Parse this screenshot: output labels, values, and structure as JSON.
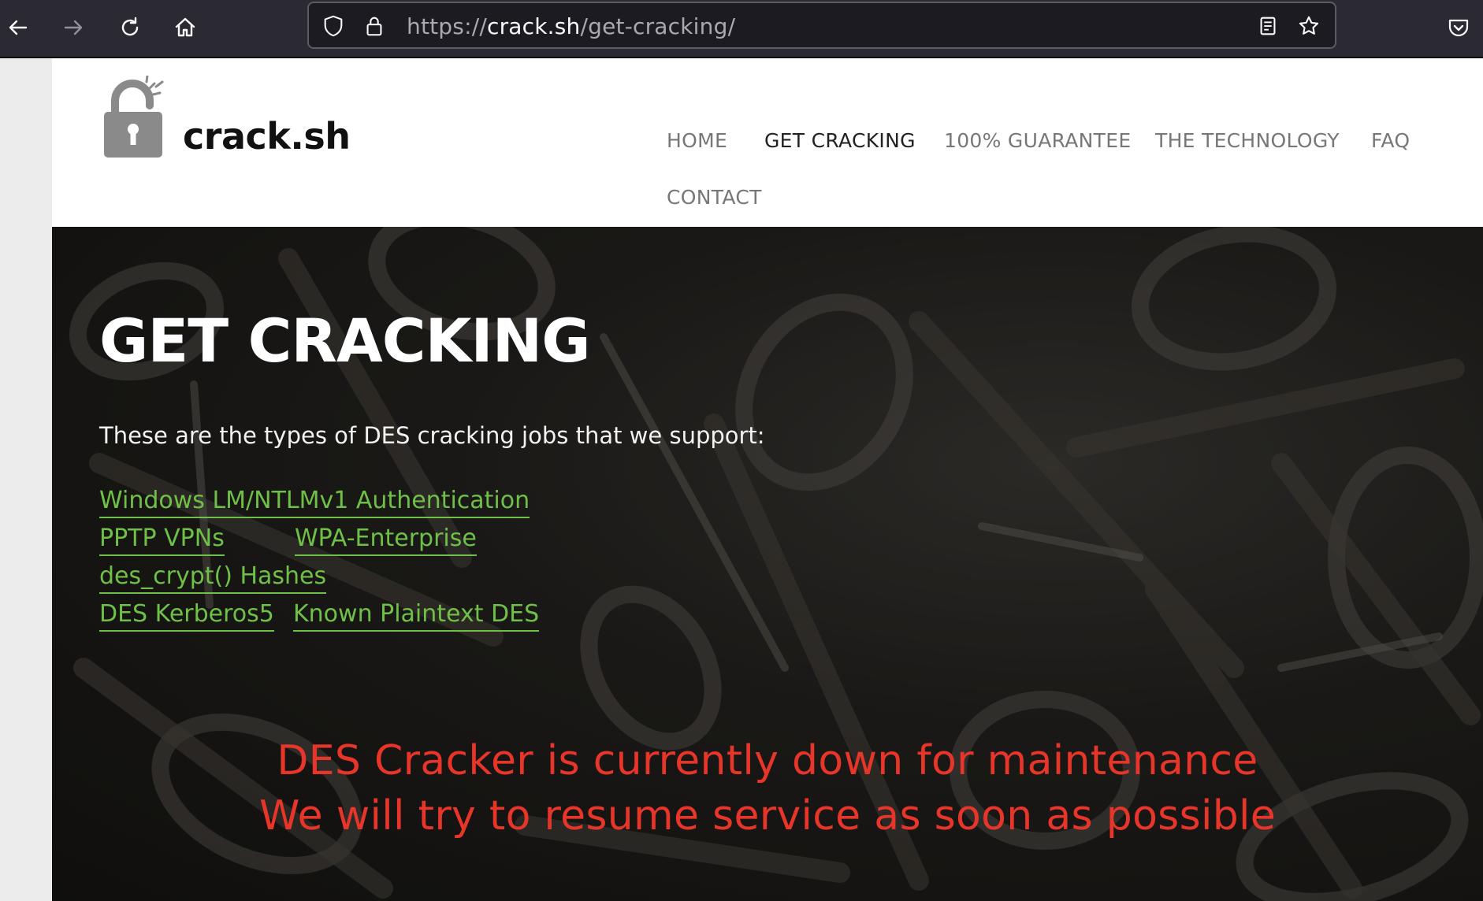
{
  "browser": {
    "url_scheme": "https://",
    "url_host": "crack.sh",
    "url_path": "/get-cracking/",
    "icons": [
      "back-arrow-icon",
      "forward-arrow-icon",
      "reload-icon",
      "home-icon",
      "shield-icon",
      "lock-icon",
      "reader-view-icon",
      "bookmark-star-icon",
      "pocket-icon"
    ]
  },
  "site": {
    "logo_text": "crack.sh",
    "nav": {
      "home": "HOME",
      "get_cracking": "GET CRACKING",
      "guarantee": "100% GUARANTEE",
      "technology": "THE TECHNOLOGY",
      "faq": "FAQ",
      "contact": "CONTACT"
    }
  },
  "hero": {
    "title": "GET CRACKING",
    "subtitle": "These are the types of DES cracking jobs that we support:",
    "jobs": [
      "Windows LM/NTLMv1 Authentication",
      "PPTP VPNs",
      "WPA-Enterprise",
      "des_crypt() Hashes",
      "DES Kerberos5",
      "Known Plaintext DES"
    ],
    "maintenance_line1": "DES Cracker is currently down for maintenance",
    "maintenance_line2": "We will try to resume service as soon as possible"
  },
  "colors": {
    "toolbar": "#2b2a33",
    "link_green": "#6fc047",
    "alert_red": "#e8352a",
    "nav_text": "#777777",
    "nav_active": "#222222"
  }
}
